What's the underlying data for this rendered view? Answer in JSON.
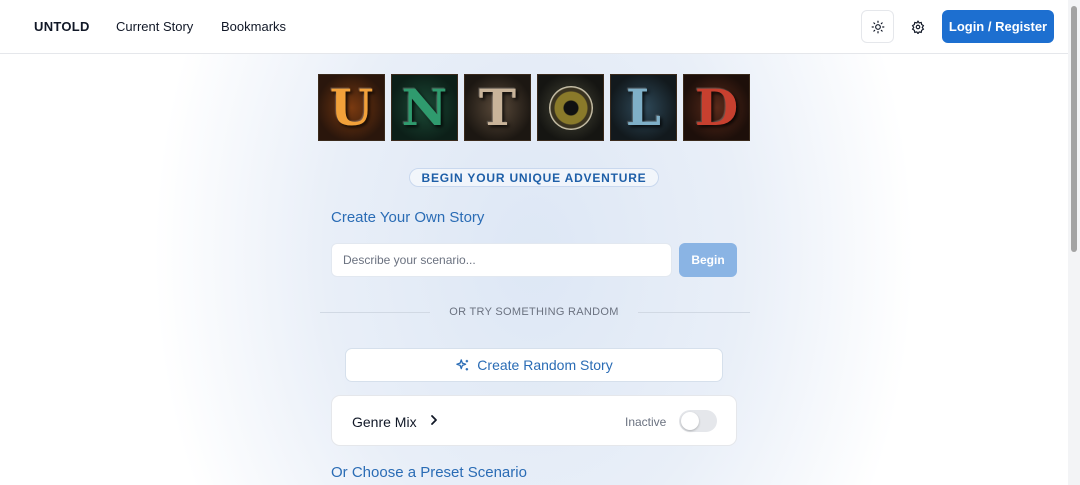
{
  "nav": {
    "brand": "UNTOLD",
    "links": [
      "Current Story",
      "Bookmarks"
    ],
    "login_label": "Login / Register",
    "theme_icon": "sun-icon",
    "settings_icon": "gear-icon"
  },
  "logo": {
    "letters": [
      "U",
      "N",
      "T",
      "O",
      "L",
      "D"
    ]
  },
  "hero": {
    "tagline": "BEGIN YOUR UNIQUE ADVENTURE",
    "create_title": "Create Your Own Story",
    "input_placeholder": "Describe your scenario...",
    "begin_label": "Begin"
  },
  "random": {
    "divider_text": "OR TRY SOMETHING RANDOM",
    "button_label": "Create Random Story",
    "button_icon": "sparkles-icon"
  },
  "genre_mix": {
    "label": "Genre Mix",
    "status": "Inactive",
    "enabled": false
  },
  "presets": {
    "title": "Or Choose a Preset Scenario"
  },
  "colors": {
    "primary": "#1d6fd0",
    "accent_text": "#2a6cb5",
    "begin_disabled": "#8ab4e4"
  }
}
